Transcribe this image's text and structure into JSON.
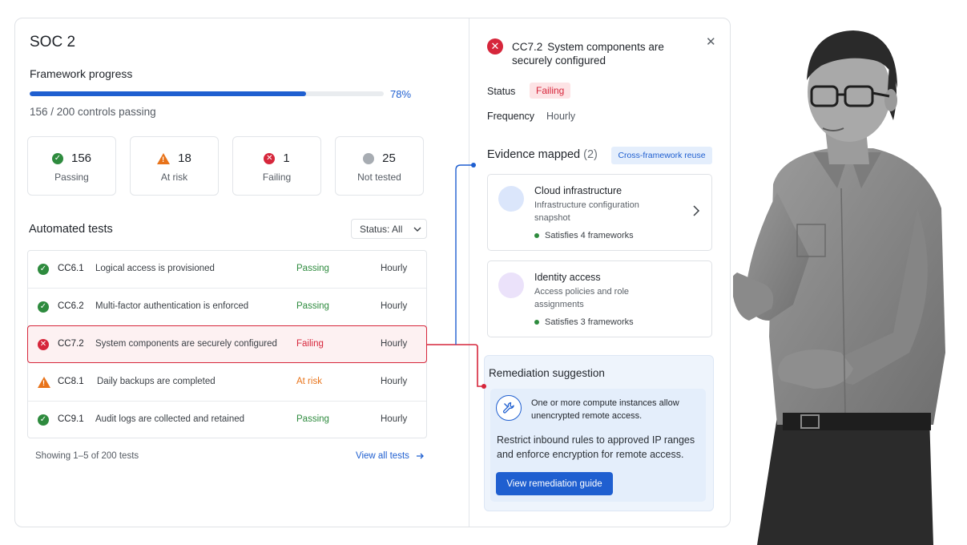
{
  "framework": {
    "title": "SOC 2",
    "progress_label": "Framework progress",
    "progress_percent": 78,
    "progress_percent_text": "78%",
    "controls_passing_text": "156 / 200 controls passing"
  },
  "stats": [
    {
      "count": "156",
      "label": "Passing",
      "icon": "check-circle-icon",
      "color": "#2e8b3e"
    },
    {
      "count": "18",
      "label": "At risk",
      "icon": "warning-triangle-icon",
      "color": "#e8731a"
    },
    {
      "count": "1",
      "label": "Failing",
      "icon": "x-circle-icon",
      "color": "#d6263b"
    },
    {
      "count": "25",
      "label": "Not tested",
      "icon": "grey-dot-icon",
      "color": "#a7acb2"
    }
  ],
  "tests": {
    "title": "Automated tests",
    "filter_label": "Status: All",
    "rows": [
      {
        "id": "CC6.1",
        "description": "Logical access is provisioned",
        "status": "Passing",
        "frequency": "Hourly"
      },
      {
        "id": "CC6.2",
        "description": "Multi-factor authentication is enforced",
        "status": "Passing",
        "frequency": "Hourly"
      },
      {
        "id": "CC7.2",
        "description": "System components are securely configured",
        "status": "Failing",
        "frequency": "Hourly"
      },
      {
        "id": "CC8.1",
        "description": "Daily backups are completed",
        "status": "At risk",
        "frequency": "Hourly"
      },
      {
        "id": "CC9.1",
        "description": "Audit logs are collected and retained",
        "status": "Passing",
        "frequency": "Hourly"
      }
    ],
    "showing_text": "Showing 1–5 of 200 tests",
    "view_all_label": "View all tests"
  },
  "detail": {
    "control_id": "CC7.2",
    "control_title": "System components are securely configured",
    "status_label": "Status",
    "status_value": "Failing",
    "frequency_label": "Frequency",
    "frequency_value": "Hourly",
    "evidence_title": "Evidence mapped",
    "evidence_count": "(2)",
    "cross_framework_badge": "Cross-framework reuse",
    "evidence": [
      {
        "name": "Cloud infrastructure",
        "subtitle": "Infrastructure configuration snapshot",
        "satisfies": "Satisfies 4 frameworks",
        "avatar_color": "#dbe6fb"
      },
      {
        "name": "Identity access",
        "subtitle": "Access policies and role assignments",
        "satisfies": "Satisfies 3 frameworks",
        "avatar_color": "#ebe2fa"
      }
    ],
    "remediation": {
      "title": "Remediation suggestion",
      "issue": "One or more compute instances allow unencrypted remote access.",
      "text": "Restrict inbound rules to approved IP ranges and enforce encryption for remote access.",
      "button_label": "View remediation guide"
    }
  },
  "colors": {
    "accent": "#1f5fd0",
    "pass": "#2e8b3e",
    "fail": "#d6263b",
    "risk": "#e8731a"
  }
}
